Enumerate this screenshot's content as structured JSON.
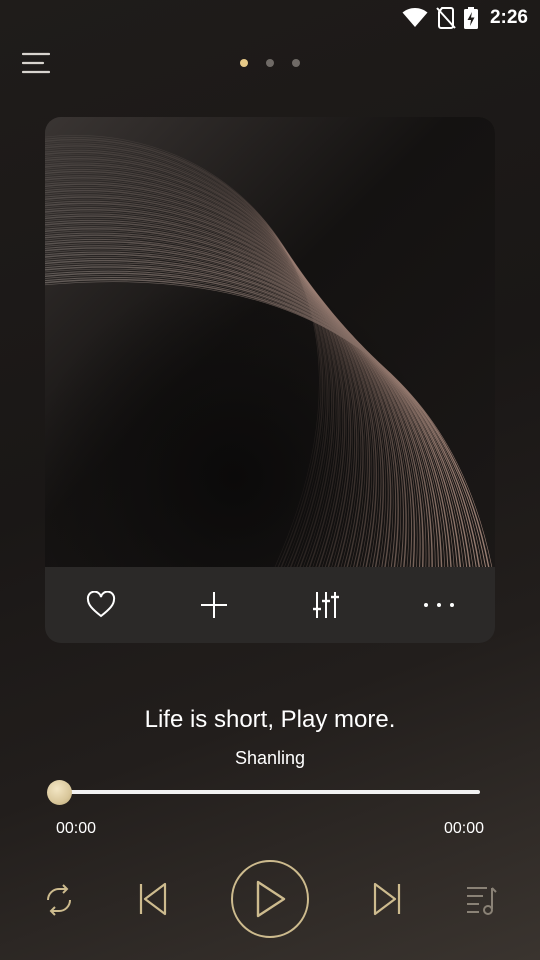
{
  "status_bar": {
    "time": "2:26",
    "icons": [
      "wifi-icon",
      "no-sim-icon",
      "battery-charging-icon"
    ]
  },
  "header": {
    "menu_icon": "menu-icon",
    "page_count": 3,
    "active_page": 0
  },
  "album": {
    "artwork": "abstract-curved-lines-artwork",
    "actions": [
      {
        "name": "favorite",
        "icon": "heart-icon"
      },
      {
        "name": "add",
        "icon": "plus-icon"
      },
      {
        "name": "equalizer",
        "icon": "equalizer-sliders-icon"
      },
      {
        "name": "more",
        "icon": "more-dots-icon"
      }
    ]
  },
  "track": {
    "title": "Life is short, Play more.",
    "artist": "Shanling",
    "current_time": "00:00",
    "total_time": "00:00",
    "progress": 0
  },
  "controls": {
    "icons": [
      "repeat-icon",
      "previous-icon",
      "play-icon",
      "next-icon",
      "playlist-icon"
    ]
  },
  "colors": {
    "accent": "#e7c988",
    "play_ring": "#cdbb8e",
    "background": "#1a1716"
  }
}
